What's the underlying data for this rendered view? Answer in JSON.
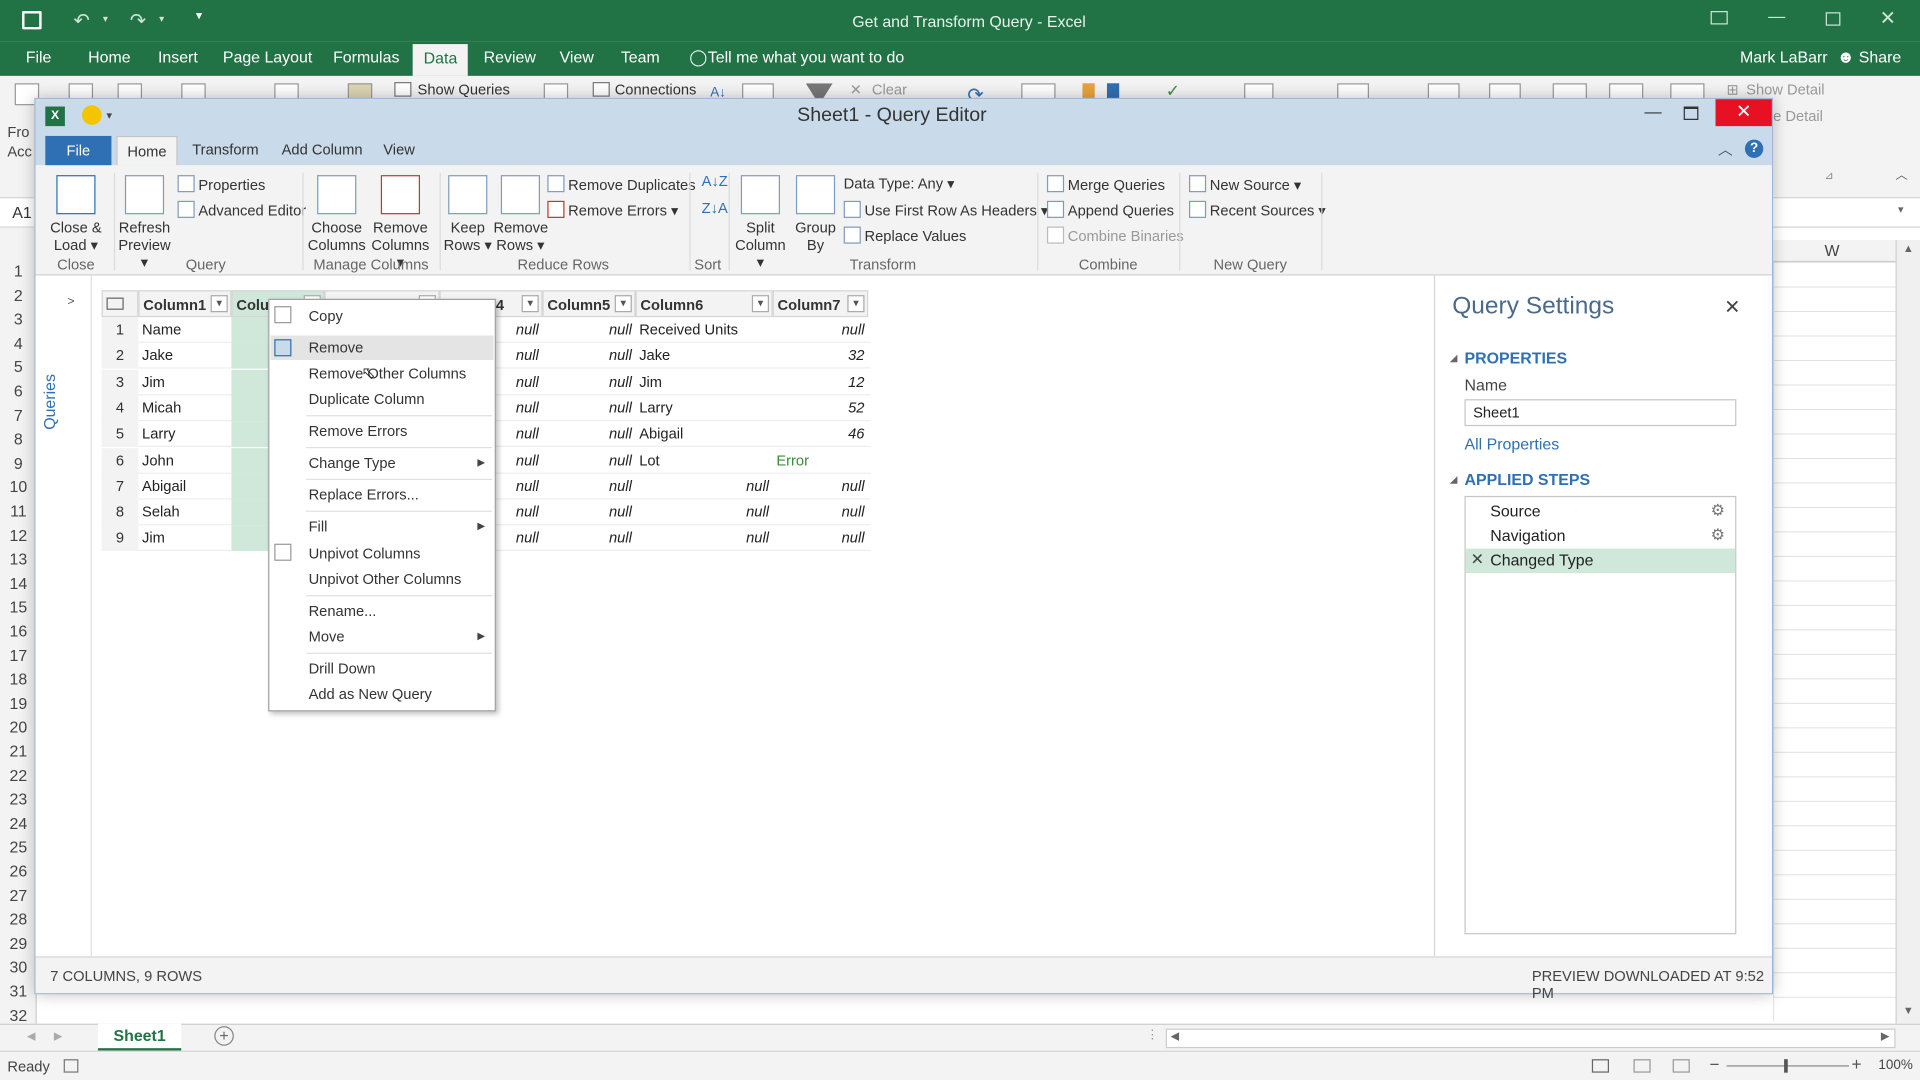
{
  "excel": {
    "doc_title": "Get and Transform Query - Excel",
    "tabs": [
      "File",
      "Home",
      "Insert",
      "Page Layout",
      "Formulas",
      "Data",
      "Review",
      "View",
      "Team"
    ],
    "tell_me": "Tell me what you want to do",
    "user": "Mark LaBarr",
    "share": "Share",
    "ribbon": {
      "show_queries": "Show Queries",
      "connections": "Connections",
      "clear": "Clear",
      "show_detail": "Show Detail",
      "hide_detail": "e Detail",
      "from_acc": "Fro Acc"
    },
    "name_box": "A1",
    "col_w": "W",
    "row_numbers": [
      "1",
      "2",
      "3",
      "4",
      "5",
      "6",
      "7",
      "8",
      "9",
      "10",
      "11",
      "12",
      "13",
      "14",
      "15",
      "16",
      "17",
      "18",
      "19",
      "20",
      "21",
      "22",
      "23",
      "24",
      "25",
      "26",
      "27",
      "28",
      "29",
      "30",
      "31",
      "32"
    ],
    "sheet_tab": "Sheet1",
    "status": "Ready",
    "zoom": "100%"
  },
  "query_editor": {
    "title": "Sheet1 - Query Editor",
    "tabs": {
      "file": "File",
      "home": "Home",
      "transform": "Transform",
      "add_column": "Add Column",
      "view": "View"
    },
    "ribbon": {
      "close_load": "Close & Load ▾",
      "refresh_preview": "Refresh Preview ▾",
      "properties": "Properties",
      "advanced_editor": "Advanced Editor",
      "choose_columns": "Choose Columns",
      "remove_columns": "Remove Columns ▾",
      "keep_rows": "Keep Rows ▾",
      "remove_rows": "Remove Rows ▾",
      "remove_duplicates": "Remove Duplicates",
      "remove_errors": "Remove Errors ▾",
      "split_column": "Split Column ▾",
      "group_by": "Group By",
      "data_type": "Data Type: Any ▾",
      "use_first_row": "Use First Row As Headers ▾",
      "replace_values": "Replace Values",
      "merge_queries": "Merge Queries",
      "append_queries": "Append Queries",
      "combine_binaries": "Combine Binaries",
      "new_source": "New Source ▾",
      "recent_sources": "Recent Sources ▾",
      "groups": {
        "close": "Close",
        "query": "Query",
        "manage_columns": "Manage Columns",
        "reduce_rows": "Reduce Rows",
        "sort": "Sort",
        "transform": "Transform",
        "combine": "Combine",
        "new_query": "New Query"
      }
    },
    "queries_label": "Queries",
    "grid": {
      "headers": [
        "Column1",
        "Colu",
        "",
        "4",
        "Column5",
        "Column6",
        "Column7"
      ],
      "rows": [
        {
          "i": "1",
          "c1": "Name",
          "c4": "null",
          "c5": "null",
          "c6": "Received Units",
          "c7": "null"
        },
        {
          "i": "2",
          "c1": "Jake",
          "c4": "null",
          "c5": "null",
          "c6": "Jake",
          "c7": "32"
        },
        {
          "i": "3",
          "c1": "Jim",
          "c4": "null",
          "c5": "null",
          "c6": "Jim",
          "c7": "12"
        },
        {
          "i": "4",
          "c1": "Micah",
          "c4": "null",
          "c5": "null",
          "c6": "Larry",
          "c7": "52"
        },
        {
          "i": "5",
          "c1": "Larry",
          "c4": "null",
          "c5": "null",
          "c6": "Abigail",
          "c7": "46"
        },
        {
          "i": "6",
          "c1": "John",
          "c4": "null",
          "c5": "null",
          "c6": "Lot",
          "c7": "Error"
        },
        {
          "i": "7",
          "c1": "Abigail",
          "c4": "null",
          "c5": "null",
          "c6": "null",
          "c7": "null"
        },
        {
          "i": "8",
          "c1": "Selah",
          "c4": "null",
          "c5": "null",
          "c6": "null",
          "c7": "null"
        },
        {
          "i": "9",
          "c1": "Jim",
          "c4": "null",
          "c5": "null",
          "c6": "null",
          "c7": "null"
        }
      ]
    },
    "context_menu": {
      "copy": "Copy",
      "remove": "Remove",
      "remove_other": "Remove Other Columns",
      "duplicate": "Duplicate Column",
      "remove_errors": "Remove Errors",
      "change_type": "Change Type",
      "replace_errors": "Replace Errors...",
      "fill": "Fill",
      "unpivot": "Unpivot Columns",
      "unpivot_other": "Unpivot Other Columns",
      "rename": "Rename...",
      "move": "Move",
      "drill_down": "Drill Down",
      "add_new_query": "Add as New Query"
    },
    "settings": {
      "title": "Query Settings",
      "properties": "PROPERTIES",
      "name_label": "Name",
      "name_value": "Sheet1",
      "all_properties": "All Properties",
      "applied_steps": "APPLIED STEPS",
      "steps": [
        "Source",
        "Navigation",
        "Changed Type"
      ]
    },
    "status_left": "7 COLUMNS, 9 ROWS",
    "status_right": "PREVIEW DOWNLOADED AT 9:52 PM"
  }
}
